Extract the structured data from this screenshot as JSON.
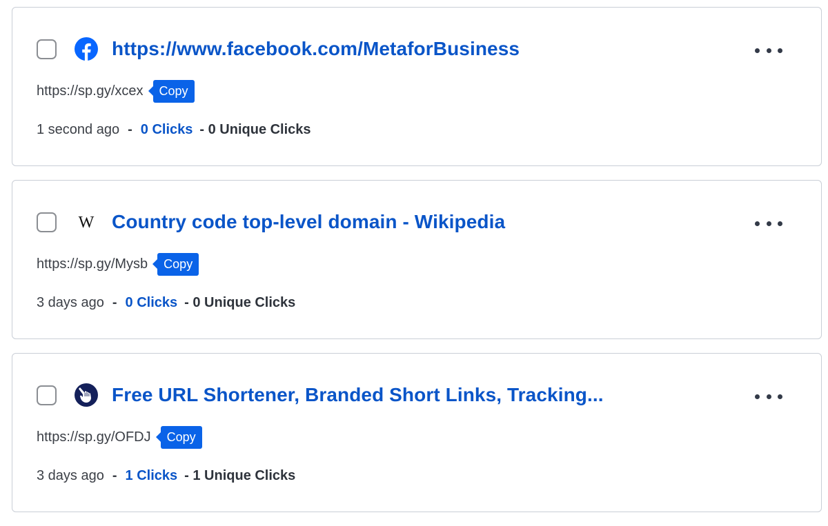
{
  "links": [
    {
      "title": "https://www.facebook.com/MetaforBusiness",
      "favicon": "facebook-icon",
      "short_url": "https://sp.gy/xcex",
      "copy_label": "Copy",
      "age": "1 second ago",
      "separator": "-",
      "clicks": "0 Clicks",
      "unique_clicks": "- 0 Unique Clicks",
      "more_icon": "more-horizontal-icon",
      "checked": false
    },
    {
      "title": "Country code top-level domain - Wikipedia",
      "favicon": "wikipedia-icon",
      "favicon_glyph": "W",
      "short_url": "https://sp.gy/Mysb",
      "copy_label": "Copy",
      "age": "3 days ago",
      "separator": "-",
      "clicks": "0 Clicks",
      "unique_clicks": "- 0 Unique Clicks",
      "more_icon": "more-horizontal-icon",
      "checked": false
    },
    {
      "title": "Free URL Shortener, Branded Short Links, Tracking...",
      "favicon": "pointing-hand-icon",
      "short_url": "https://sp.gy/OFDJ",
      "copy_label": "Copy",
      "age": "3 days ago",
      "separator": "-",
      "clicks": "1 Clicks",
      "unique_clicks": "- 1 Unique Clicks",
      "more_icon": "more-horizontal-icon",
      "checked": false
    }
  ],
  "colors": {
    "link_blue": "#0a55c8",
    "copy_button_blue": "#0a63e8",
    "facebook_blue": "#0866ff",
    "favicon_navy": "#14205a",
    "text_gray": "#3b3f46",
    "border_gray": "#c9ced6"
  }
}
